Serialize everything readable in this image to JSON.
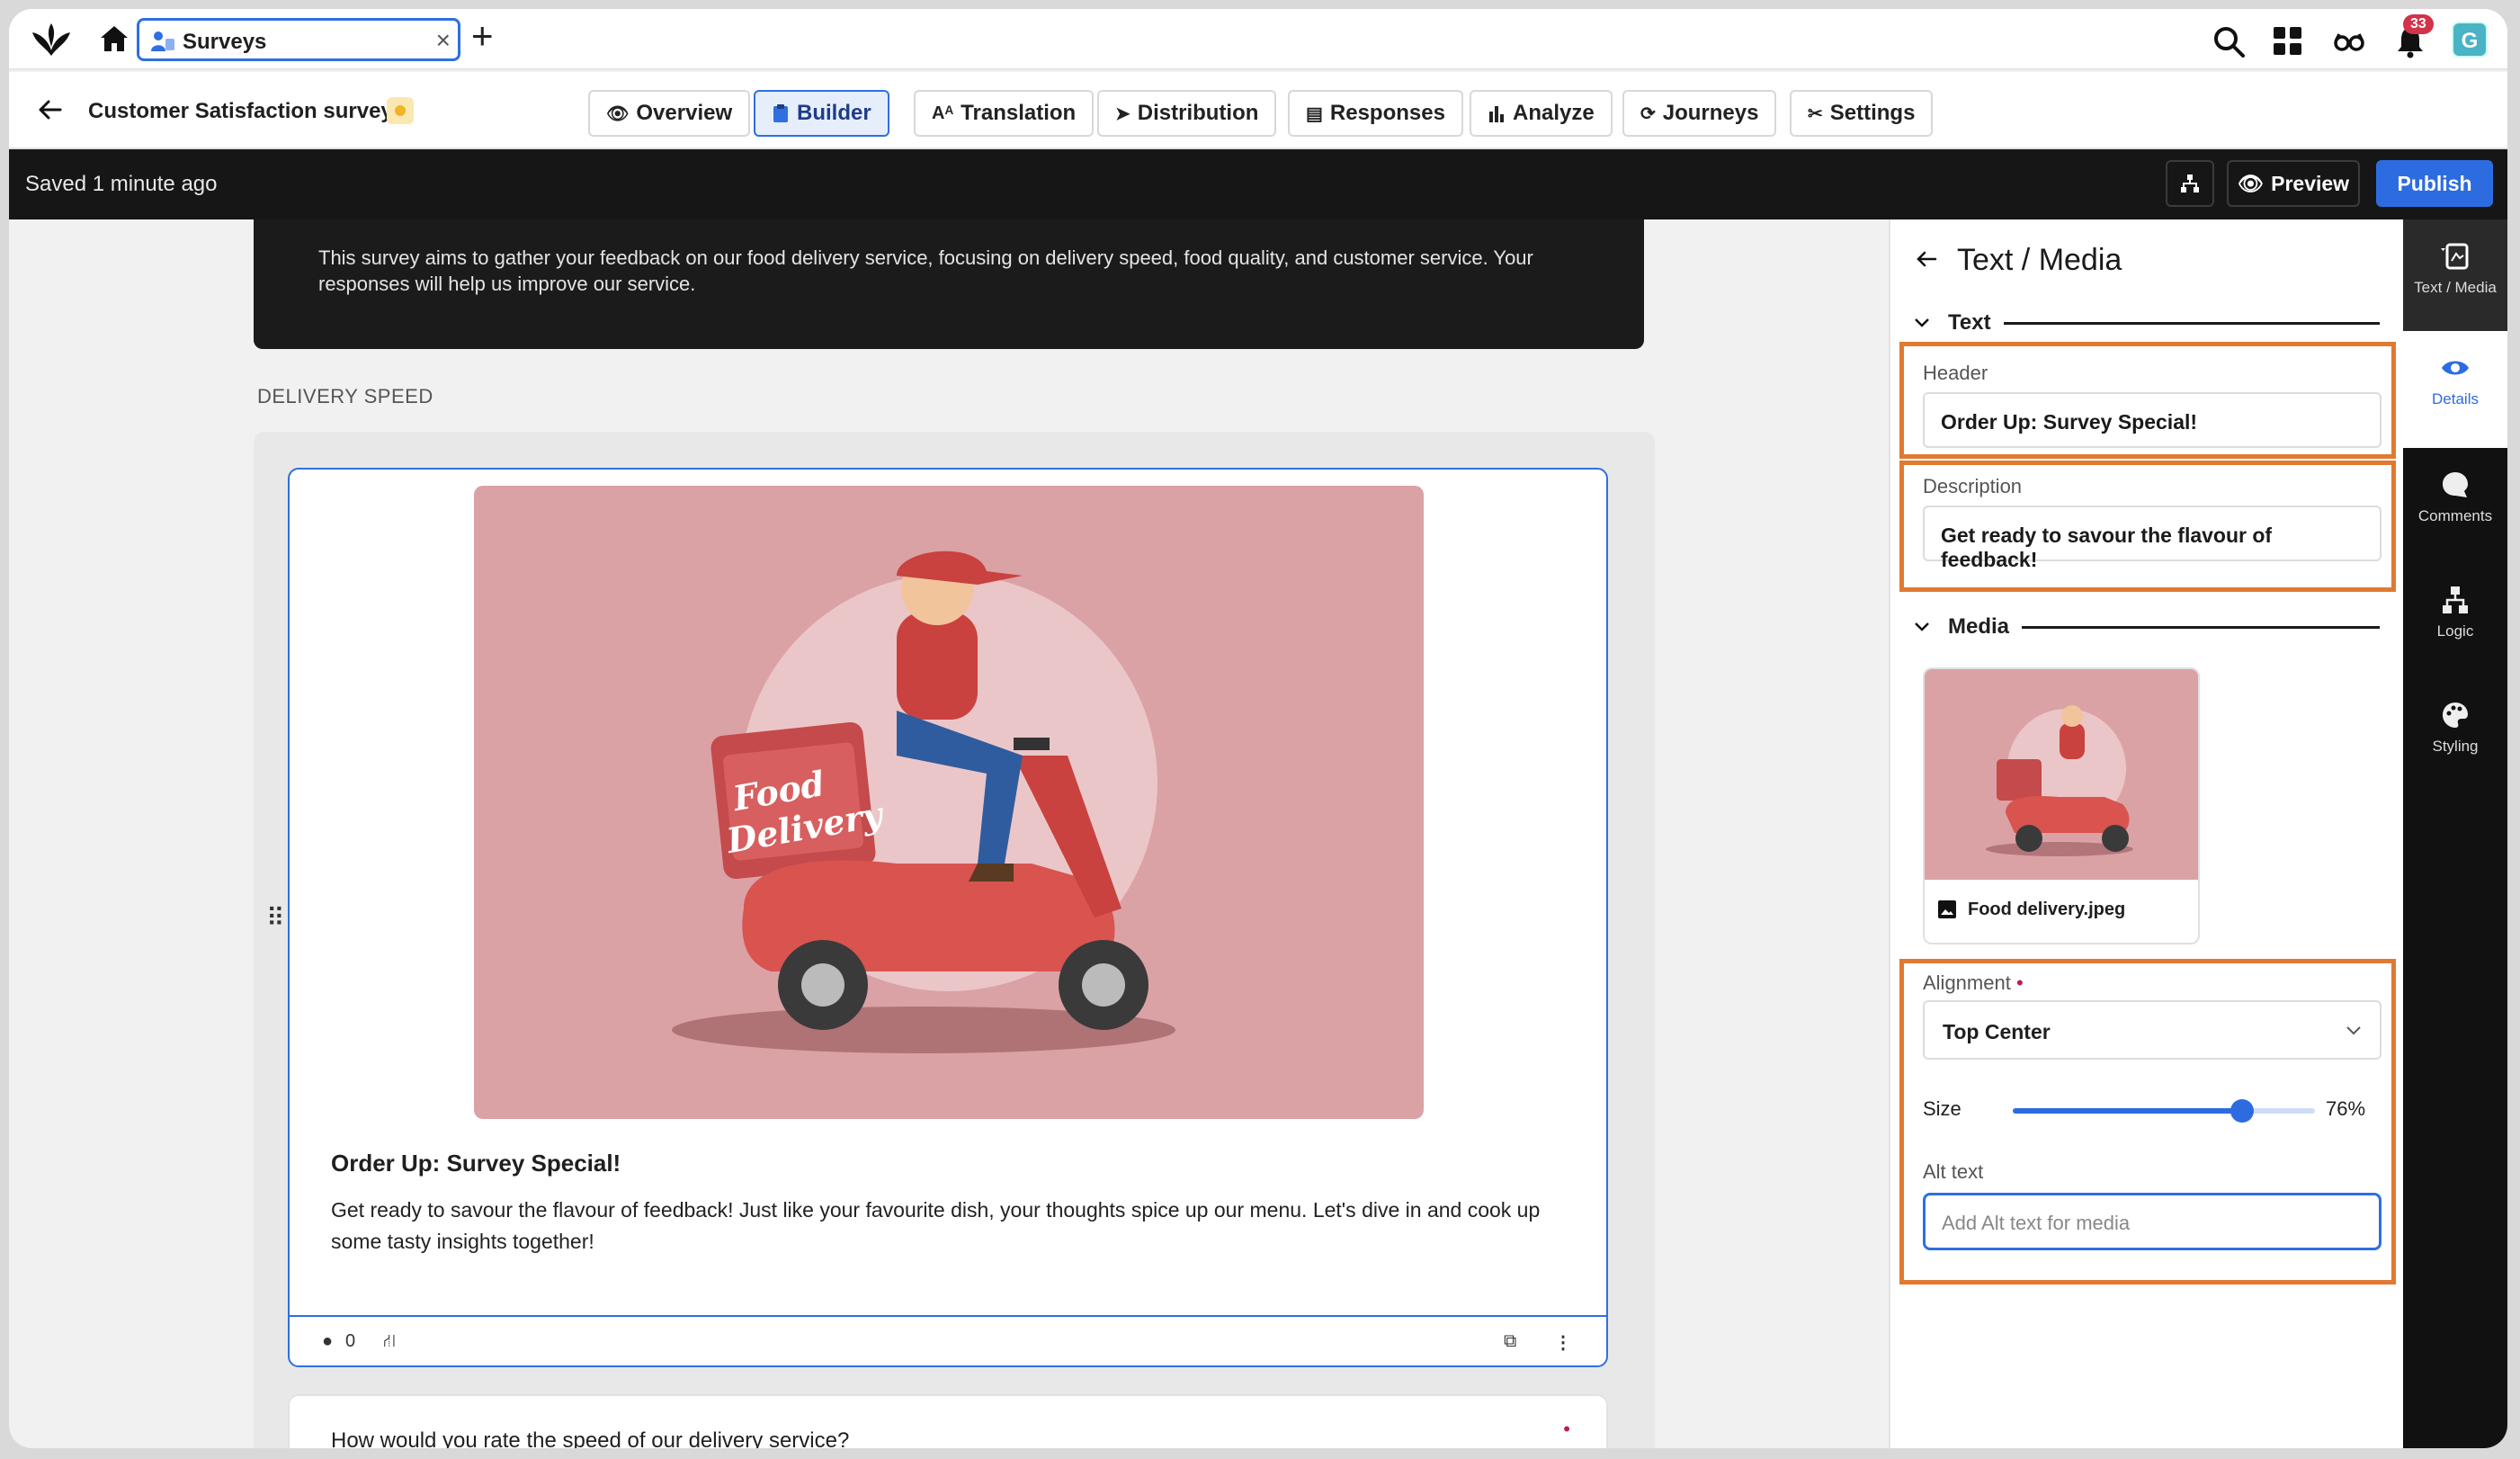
{
  "topbar": {
    "tab_label": "Surveys",
    "tab_close": "×",
    "new_tab": "+",
    "notification_count": "33",
    "avatar_initial": "G"
  },
  "nav": {
    "survey_title": "Customer Satisfaction survey",
    "tabs": [
      {
        "label": "Overview",
        "icon": "eye-icon",
        "active": false
      },
      {
        "label": "Builder",
        "icon": "builder-icon",
        "active": true
      },
      {
        "label": "Translation",
        "icon": "translate-icon",
        "active": false
      },
      {
        "label": "Distribution",
        "icon": "send-icon",
        "active": false
      },
      {
        "label": "Responses",
        "icon": "list-icon",
        "active": false
      },
      {
        "label": "Analyze",
        "icon": "bar-chart-icon",
        "active": false
      },
      {
        "label": "Journeys",
        "icon": "journey-icon",
        "active": false
      },
      {
        "label": "Settings",
        "icon": "tools-icon",
        "active": false
      }
    ]
  },
  "darkbar": {
    "saved_text": "Saved 1 minute ago",
    "preview_label": "Preview",
    "publish_label": "Publish"
  },
  "canvas": {
    "intro_text": "This survey aims to gather your feedback on our food delivery service, focusing on delivery speed, food quality, and customer service. Your responses will help us improve our service.",
    "section_label": "DELIVERY SPEED",
    "card": {
      "title": "Order Up: Survey Special!",
      "description": "Get ready to savour the flavour of feedback! Just like your favourite dish, your thoughts spice up our menu. Let's dive in and cook up some tasty insights together!",
      "comment_count": "0",
      "image_text_line1": "Food",
      "image_text_line2": "Delivery"
    },
    "next_question": "How would you rate the speed of our delivery service?",
    "required_mark": "•"
  },
  "panel": {
    "title": "Text / Media",
    "text_section": "Text",
    "header_label": "Header",
    "header_value": "Order Up: Survey Special!",
    "description_label": "Description",
    "description_value": "Get ready to savour the flavour of feedback!",
    "media_section": "Media",
    "media_filename": "Food delivery.jpeg",
    "alignment_label": "Alignment",
    "alignment_required": "•",
    "alignment_value": "Top Center",
    "size_label": "Size",
    "size_value": "76%",
    "size_fraction": 0.76,
    "alt_label": "Alt text",
    "alt_placeholder": "Add Alt text for media"
  },
  "rail": {
    "items": [
      {
        "label": "Text / Media",
        "icon": "text-media-icon"
      },
      {
        "label": "Details",
        "icon": "eye-icon"
      },
      {
        "label": "Comments",
        "icon": "comment-icon"
      },
      {
        "label": "Logic",
        "icon": "logic-icon"
      },
      {
        "label": "Styling",
        "icon": "palette-icon"
      }
    ]
  },
  "colors": {
    "accent": "#2d6ce0",
    "highlight": "#e07a32",
    "hero_bg": "#dba2a5"
  }
}
